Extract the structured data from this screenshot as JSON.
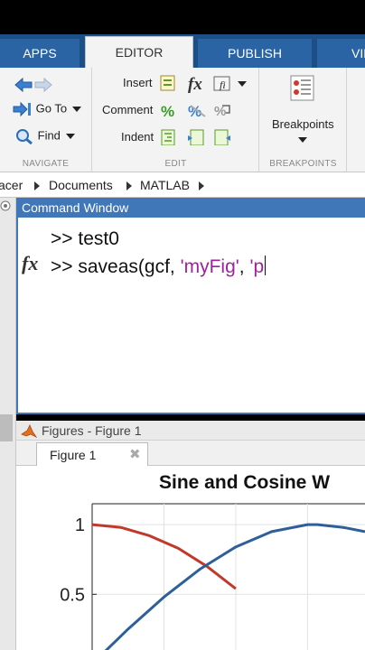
{
  "tabs": [
    "APPS",
    "EDITOR",
    "PUBLISH",
    "VIE"
  ],
  "ribbon": {
    "navigate": {
      "label": "NAVIGATE",
      "goto": "Go To",
      "find": "Find"
    },
    "edit": {
      "label": "EDIT",
      "insert": "Insert",
      "comment": "Comment",
      "indent": "Indent"
    },
    "breakpoints": {
      "label": "BREAKPOINTS",
      "button": "Breakpoints"
    }
  },
  "breadcrumb": [
    "acer",
    "Documents",
    "MATLAB"
  ],
  "command_window": {
    "title": "Command Window",
    "line1": ">> test0",
    "line2_prefix": ">> saveas(gcf, ",
    "line2_str1": "'myFig'",
    "line2_comma": ", ",
    "line2_str2": "'p"
  },
  "figures": {
    "title": "Figures - Figure 1",
    "tab": "Figure 1",
    "close_glyph": "✖"
  },
  "chart_data": {
    "type": "line",
    "title": "Sine and Cosine W",
    "xlim": [
      0,
      1.9
    ],
    "ylim": [
      0.1,
      1.15
    ],
    "yticks": [
      0.5,
      1
    ],
    "ytick_labels": [
      "0.5",
      "1"
    ],
    "grid": true,
    "series": [
      {
        "color": "#c0392b",
        "x": [
          0,
          0.2,
          0.4,
          0.6,
          0.8,
          1.0
        ],
        "y": [
          1.0,
          0.98,
          0.92,
          0.83,
          0.7,
          0.54
        ]
      },
      {
        "color": "#2f5f98",
        "x": [
          0,
          0.25,
          0.5,
          0.75,
          1.0,
          1.25,
          1.5,
          1.57,
          1.75,
          1.9
        ],
        "y": [
          0.0,
          0.25,
          0.48,
          0.68,
          0.84,
          0.95,
          1.0,
          1.0,
          0.98,
          0.95
        ]
      }
    ]
  },
  "colors": {
    "tab_bar": "#1b4f86",
    "title_bar": "#3f77b9",
    "string": "#a020a0"
  }
}
